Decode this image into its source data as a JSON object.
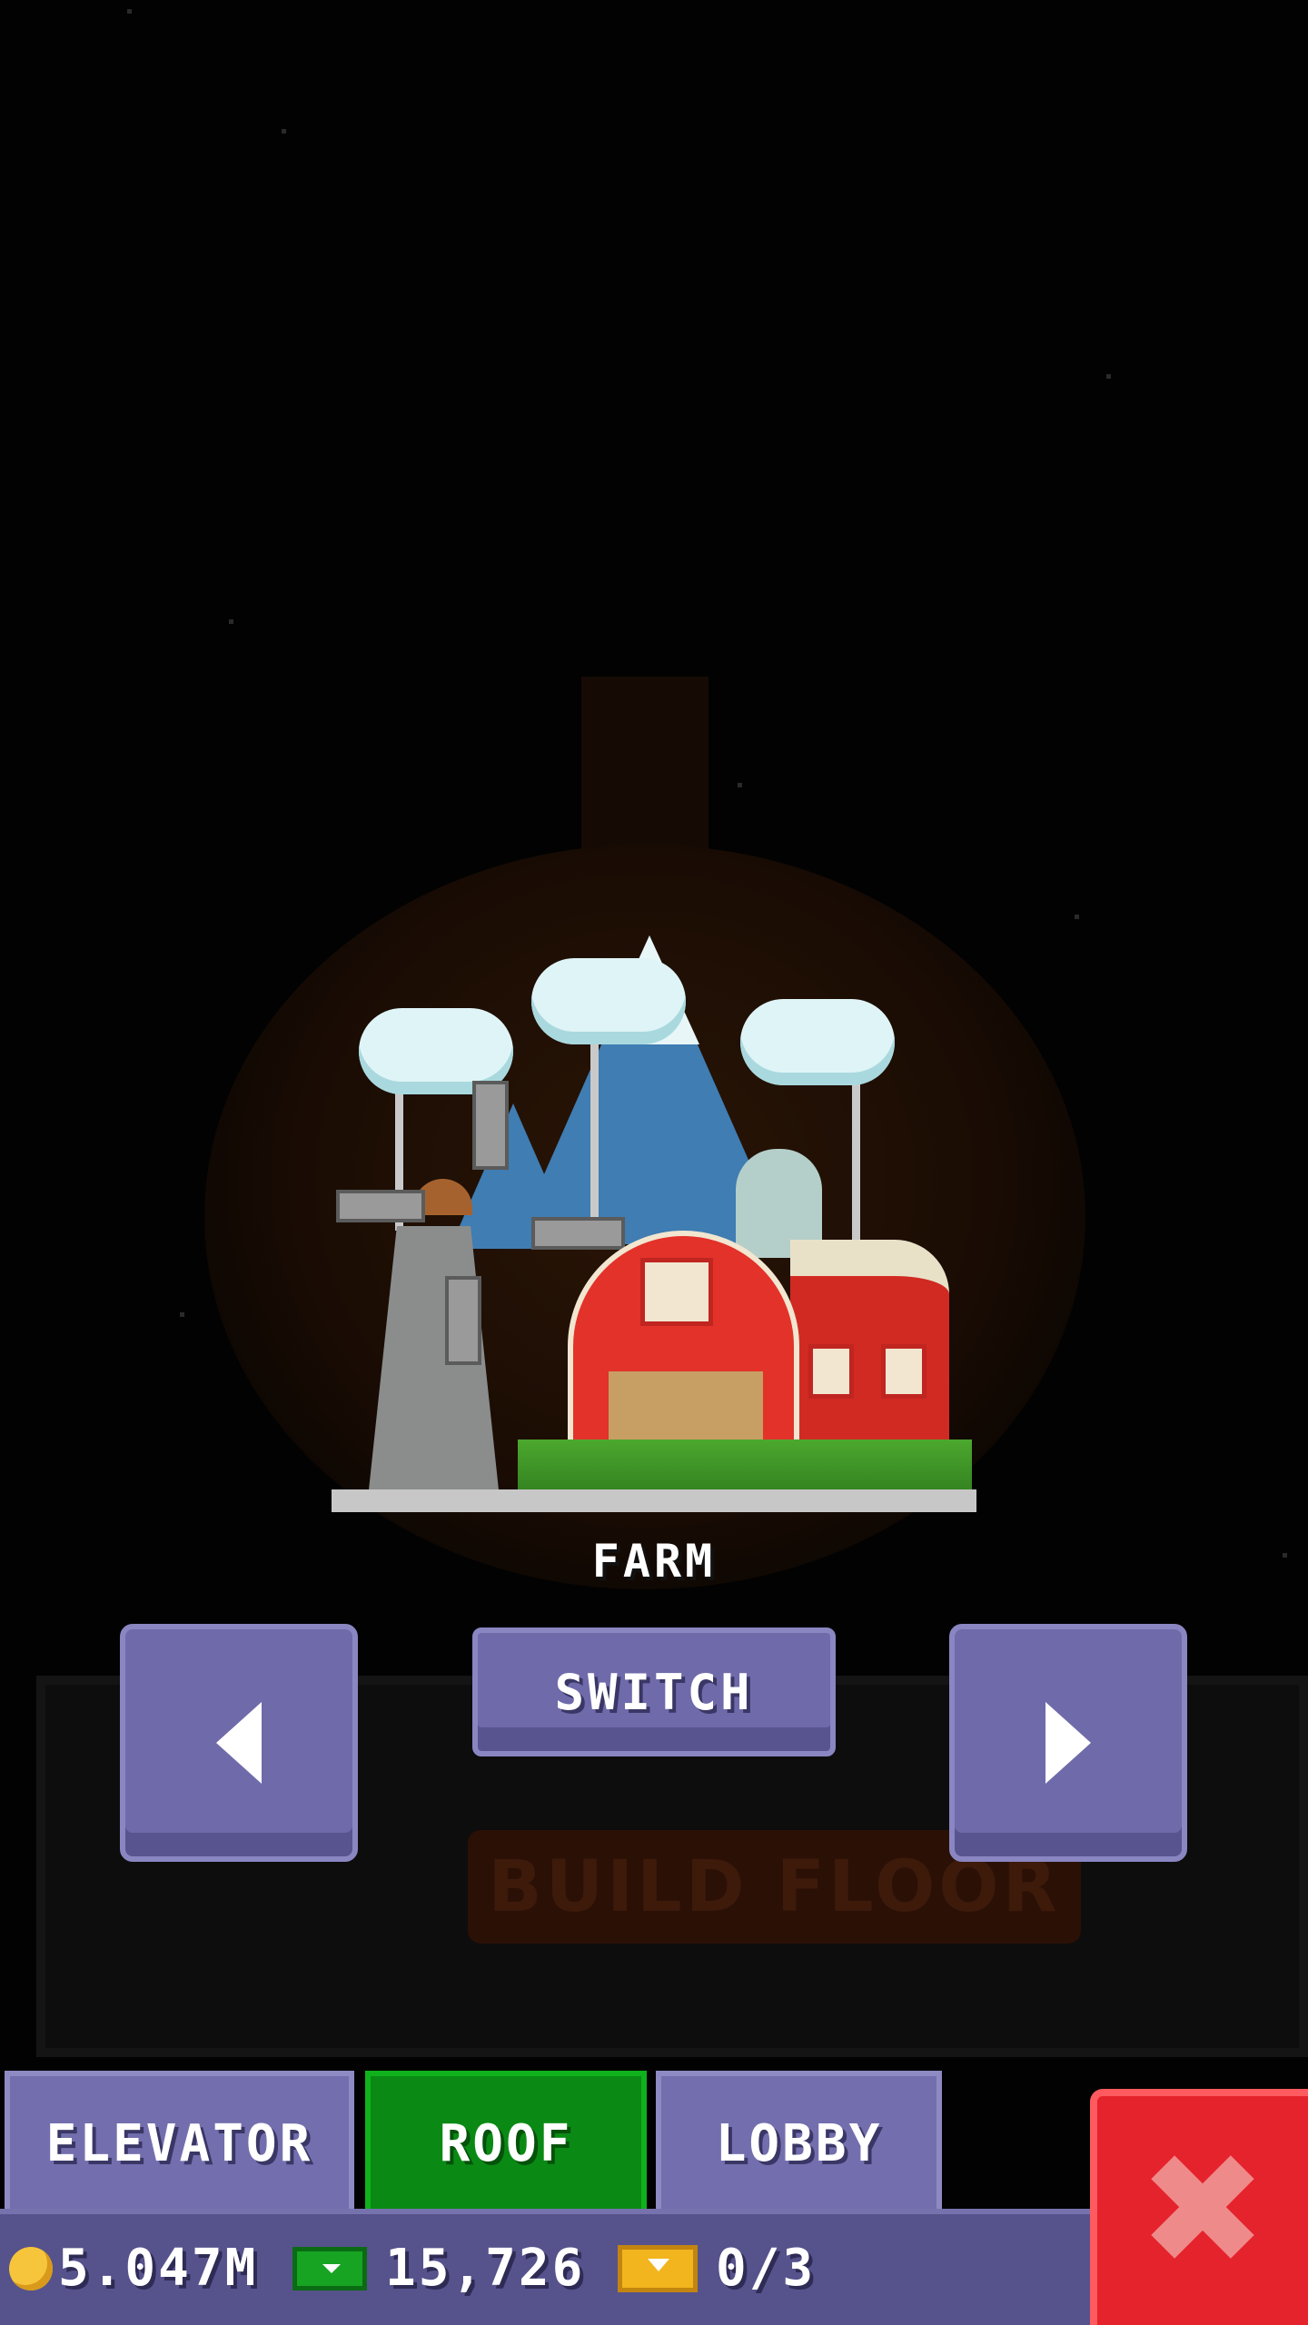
{
  "floor_preview": {
    "name": "FARM"
  },
  "controls": {
    "switch_label": "SWITCH",
    "prev_icon": "arrow-left-icon",
    "next_icon": "arrow-right-icon"
  },
  "background": {
    "build_floor_label": "BUILD FLOOR"
  },
  "tabs": [
    {
      "label": "ELEVATOR",
      "active": false
    },
    {
      "label": "ROOF",
      "active": true
    },
    {
      "label": "LOBBY",
      "active": false
    }
  ],
  "close": {
    "icon": "close-icon"
  },
  "status": {
    "coins": "5.047M",
    "bux": "15,726",
    "tickets": "0/3"
  },
  "colors": {
    "button_purple": "#6f6aaa",
    "tab_active_green": "#0a8a14",
    "close_red": "#e5232c"
  }
}
